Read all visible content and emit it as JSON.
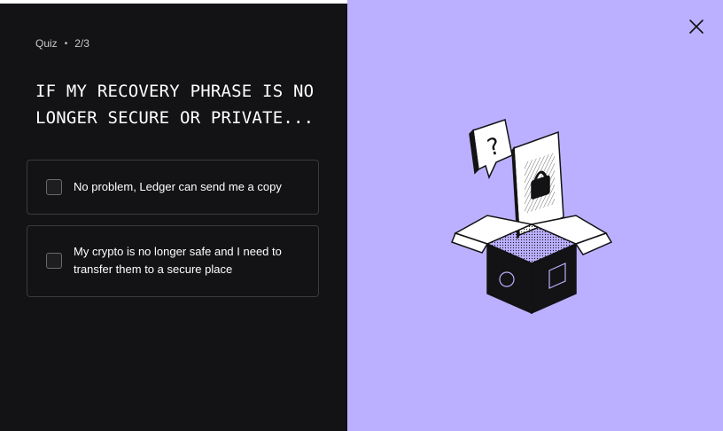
{
  "progress": {
    "fraction": 0.667
  },
  "header": {
    "section": "Quiz",
    "separator": "•",
    "step": "2/3"
  },
  "question": {
    "text": "IF MY RECOVERY PHRASE IS NO LONGER SECURE OR PRIVATE..."
  },
  "answers": [
    {
      "label": "No problem, Ledger can send me a copy",
      "checked": false
    },
    {
      "label": "My crypto is no longer safe and I need to transfer them to a secure place",
      "checked": false
    }
  ],
  "close": {
    "icon": "close-icon"
  },
  "illustration": {
    "icon": "lock-box-icon"
  },
  "colors": {
    "background": "#131214",
    "accent": "#bbb0ff",
    "text": "#ffffff",
    "border": "#3a3a3c"
  }
}
